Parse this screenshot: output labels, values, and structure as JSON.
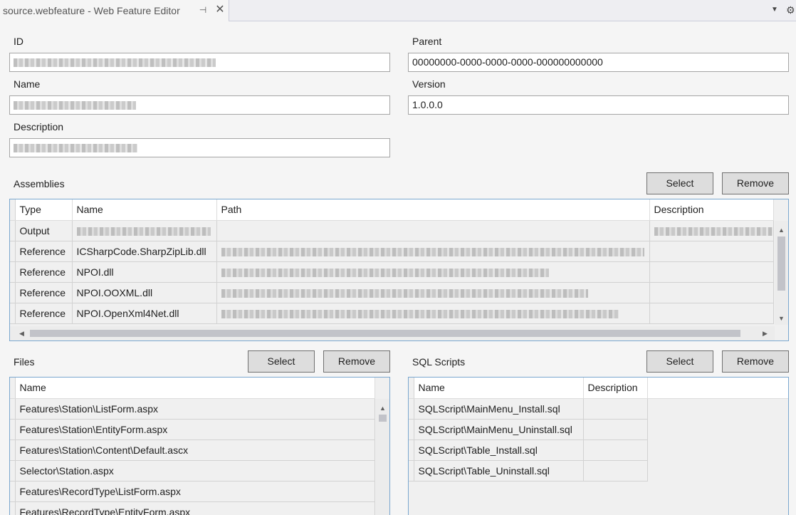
{
  "tab": {
    "title": "source.webfeature - Web Feature Editor",
    "pin_glyph": "⊣",
    "close_glyph": "✕",
    "dropdown_glyph": "▼",
    "gear_glyph": "⚙"
  },
  "form": {
    "id_label": "ID",
    "parent_label": "Parent",
    "parent_value": "00000000-0000-0000-0000-000000000000",
    "name_label": "Name",
    "version_label": "Version",
    "version_value": "1.0.0.0",
    "description_label": "Description"
  },
  "assemblies": {
    "label": "Assemblies",
    "select_label": "Select",
    "remove_label": "Remove",
    "columns": [
      "Type",
      "Name",
      "Path",
      "Description"
    ],
    "rows": [
      {
        "type": "Output",
        "name": ""
      },
      {
        "type": "Reference",
        "name": "ICSharpCode.SharpZipLib.dll"
      },
      {
        "type": "Reference",
        "name": "NPOI.dll"
      },
      {
        "type": "Reference",
        "name": "NPOI.OOXML.dll"
      },
      {
        "type": "Reference",
        "name": "NPOI.OpenXml4Net.dll"
      }
    ]
  },
  "files": {
    "label": "Files",
    "select_label": "Select",
    "remove_label": "Remove",
    "column": "Name",
    "rows": [
      "Features\\Station\\ListForm.aspx",
      "Features\\Station\\EntityForm.aspx",
      "Features\\Station\\Content\\Default.ascx",
      "Selector\\Station.aspx",
      "Features\\RecordType\\ListForm.aspx",
      "Features\\RecordType\\EntityForm.aspx"
    ]
  },
  "sql_scripts": {
    "label": "SQL Scripts",
    "select_label": "Select",
    "remove_label": "Remove",
    "columns": [
      "Name",
      "Description"
    ],
    "rows": [
      "SQLScript\\MainMenu_Install.sql",
      "SQLScript\\MainMenu_Uninstall.sql",
      "SQLScript\\Table_Install.sql",
      "SQLScript\\Table_Uninstall.sql"
    ]
  },
  "scroll_glyphs": {
    "up": "▲",
    "down": "▼",
    "left": "◀",
    "right": "▶"
  }
}
